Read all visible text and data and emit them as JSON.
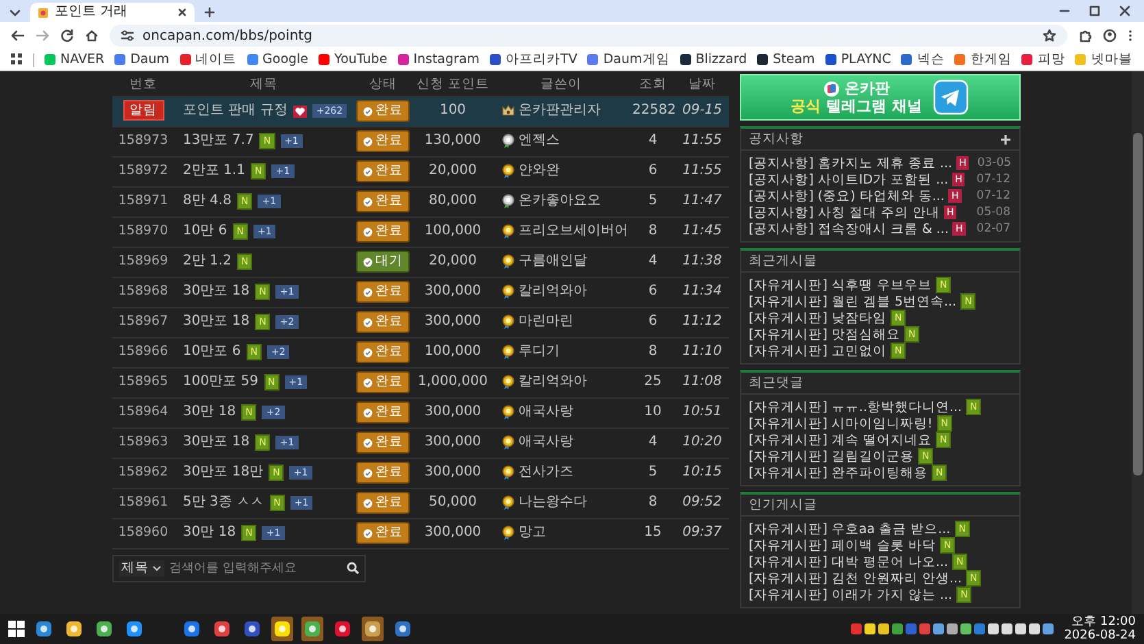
{
  "browser": {
    "tab": {
      "title": "포인트 거래"
    },
    "url": "oncapan.com/bbs/pointg",
    "bookmarks": [
      {
        "label": "NAVER",
        "color": "#03c75a"
      },
      {
        "label": "Daum",
        "color": "#4a7cf0"
      },
      {
        "label": "네이트",
        "color": "#e8202a"
      },
      {
        "label": "Google",
        "color": "#4285f4"
      },
      {
        "label": "YouTube",
        "color": "#ff0000"
      },
      {
        "label": "Instagram",
        "color": "#d6249f"
      },
      {
        "label": "아프리카TV",
        "color": "#2a4fc8"
      },
      {
        "label": "Daum게임",
        "color": "#5a7cf0"
      },
      {
        "label": "Blizzard",
        "color": "#1a2a3a"
      },
      {
        "label": "Steam",
        "color": "#1b2838"
      },
      {
        "label": "PLAYNC",
        "color": "#1a4fd0"
      },
      {
        "label": "넥슨",
        "color": "#2a6ad0"
      },
      {
        "label": "한게임",
        "color": "#f07020"
      },
      {
        "label": "피망",
        "color": "#e82040"
      },
      {
        "label": "넷마블",
        "color": "#f0c020"
      }
    ]
  },
  "table": {
    "columns": [
      "번호",
      "제목",
      "상태",
      "신청 포인트",
      "글쓴이",
      "조회",
      "날짜"
    ],
    "rows": [
      {
        "kind": "notice",
        "number": "알림",
        "title": "포인트 판매 규정",
        "hot": true,
        "comments": "+262",
        "status": {
          "label": "완료",
          "kind": "done"
        },
        "points": "100",
        "writer": "온카판관리자",
        "medal": {
          "kind": "admin"
        },
        "views": "22582",
        "date": "09-15"
      },
      {
        "kind": "post",
        "number": "158973",
        "title": "13만포 7.7",
        "hot": false,
        "new_badge": "N",
        "comments": "+1",
        "status": {
          "label": "완료",
          "kind": "done"
        },
        "points": "130,000",
        "writer": "엔젝스",
        "medal": {
          "kind": "silver"
        },
        "views": "4",
        "date": "11:55"
      },
      {
        "kind": "post",
        "number": "158972",
        "title": "2만포 1.1",
        "hot": false,
        "new_badge": "N",
        "comments": "+1",
        "status": {
          "label": "완료",
          "kind": "done"
        },
        "points": "20,000",
        "writer": "얀와완",
        "medal": {
          "kind": "gold"
        },
        "views": "6",
        "date": "11:55"
      },
      {
        "kind": "post",
        "number": "158971",
        "title": "8만 4.8",
        "hot": false,
        "new_badge": "N",
        "comments": "+1",
        "status": {
          "label": "완료",
          "kind": "done"
        },
        "points": "80,000",
        "writer": "온카좋아요오",
        "medal": {
          "kind": "silver"
        },
        "views": "5",
        "date": "11:47"
      },
      {
        "kind": "post",
        "number": "158970",
        "title": "10만 6",
        "hot": false,
        "new_badge": "N",
        "comments": "+1",
        "status": {
          "label": "완료",
          "kind": "done"
        },
        "points": "100,000",
        "writer": "프리오브세이버어",
        "medal": {
          "kind": "gold"
        },
        "views": "8",
        "date": "11:45"
      },
      {
        "kind": "post",
        "number": "158969",
        "title": "2만 1.2",
        "hot": false,
        "new_badge": "N",
        "status": {
          "label": "대기",
          "kind": "waiting"
        },
        "points": "20,000",
        "writer": "구름애인달",
        "medal": {
          "kind": "gold"
        },
        "views": "4",
        "date": "11:38"
      },
      {
        "kind": "post",
        "number": "158968",
        "title": "30만포 18",
        "hot": false,
        "new_badge": "N",
        "comments": "+1",
        "status": {
          "label": "완료",
          "kind": "done"
        },
        "points": "300,000",
        "writer": "칼리억와아",
        "medal": {
          "kind": "gold"
        },
        "views": "6",
        "date": "11:34"
      },
      {
        "kind": "post",
        "number": "158967",
        "title": "30만포 18",
        "hot": false,
        "new_badge": "N",
        "comments": "+2",
        "status": {
          "label": "완료",
          "kind": "done"
        },
        "points": "300,000",
        "writer": "마린마린",
        "medal": {
          "kind": "gold"
        },
        "views": "6",
        "date": "11:12"
      },
      {
        "kind": "post",
        "number": "158966",
        "title": "10만포 6",
        "hot": false,
        "new_badge": "N",
        "comments": "+2",
        "status": {
          "label": "완료",
          "kind": "done"
        },
        "points": "100,000",
        "writer": "루디기",
        "medal": {
          "kind": "gold"
        },
        "views": "8",
        "date": "11:10"
      },
      {
        "kind": "post",
        "number": "158965",
        "title": "100만포 59",
        "hot": false,
        "new_badge": "N",
        "comments": "+1",
        "status": {
          "label": "완료",
          "kind": "done"
        },
        "points": "1,000,000",
        "writer": "칼리억와아",
        "medal": {
          "kind": "gold"
        },
        "views": "25",
        "date": "11:08"
      },
      {
        "kind": "post",
        "number": "158964",
        "title": "30만 18",
        "hot": false,
        "new_badge": "N",
        "comments": "+2",
        "status": {
          "label": "완료",
          "kind": "done"
        },
        "points": "300,000",
        "writer": "애국사랑",
        "medal": {
          "kind": "gold"
        },
        "views": "10",
        "date": "10:51"
      },
      {
        "kind": "post",
        "number": "158963",
        "title": "30만포 18",
        "hot": false,
        "new_badge": "N",
        "comments": "+1",
        "status": {
          "label": "완료",
          "kind": "done"
        },
        "points": "300,000",
        "writer": "애국사랑",
        "medal": {
          "kind": "gold"
        },
        "views": "4",
        "date": "10:20"
      },
      {
        "kind": "post",
        "number": "158962",
        "title": "30만포 18만",
        "hot": false,
        "new_badge": "N",
        "comments": "+1",
        "status": {
          "label": "완료",
          "kind": "done"
        },
        "points": "300,000",
        "writer": "전사가즈",
        "medal": {
          "kind": "gold"
        },
        "views": "5",
        "date": "10:15"
      },
      {
        "kind": "post",
        "number": "158961",
        "title": "5만 3종 ㅅㅅ",
        "hot": false,
        "new_badge": "N",
        "comments": "+1",
        "status": {
          "label": "완료",
          "kind": "done"
        },
        "points": "50,000",
        "writer": "나는왕수다",
        "medal": {
          "kind": "gold"
        },
        "views": "8",
        "date": "09:52"
      },
      {
        "kind": "post",
        "number": "158960",
        "title": "30만 18",
        "hot": false,
        "new_badge": "N",
        "comments": "+1",
        "status": {
          "label": "완료",
          "kind": "done"
        },
        "points": "300,000",
        "writer": "망고",
        "medal": {
          "kind": "gold"
        },
        "views": "15",
        "date": "09:37"
      }
    ]
  },
  "search": {
    "field": "제목",
    "placeholder": "검색어를 입력해주세요"
  },
  "sidebar": {
    "banner": {
      "title": "온카판",
      "highlight": "공식",
      "subtitle": "텔레그램 채널"
    },
    "panels": [
      {
        "title": "공지사항",
        "more": true,
        "items": [
          {
            "text": "[공지사항] 홈카지노 제휴 종료 ...",
            "badge": {
              "label": "H",
              "kind": "hot"
            },
            "date": "03-05"
          },
          {
            "text": "[공지사항] 사이트ID가 포함된 ...",
            "badge": {
              "label": "H",
              "kind": "hot"
            },
            "date": "07-12"
          },
          {
            "text": "[공지사항] (중요) 타업체와 동...",
            "badge": {
              "label": "H",
              "kind": "hot"
            },
            "date": "07-12"
          },
          {
            "text": "[공지사항] 사칭 절대 주의 안내",
            "badge": {
              "label": "H",
              "kind": "hot"
            },
            "date": "05-08"
          },
          {
            "text": "[공지사항] 접속장애시 크롬 & ...",
            "badge": {
              "label": "H",
              "kind": "hot"
            },
            "date": "02-07"
          }
        ]
      },
      {
        "title": "최근게시물",
        "more": false,
        "items": [
          {
            "text": "[자유게시판] 식후땡 우브우브",
            "badge": {
              "label": "N",
              "kind": "new"
            }
          },
          {
            "text": "[자유게시판] 월린 겜블 5번연속...",
            "badge": {
              "label": "N",
              "kind": "new"
            }
          },
          {
            "text": "[자유게시판] 낮잠타임",
            "badge": {
              "label": "N",
              "kind": "new"
            }
          },
          {
            "text": "[자유게시판] 맛점심해요",
            "badge": {
              "label": "N",
              "kind": "new"
            }
          },
          {
            "text": "[자유게시판] 고민없이",
            "badge": {
              "label": "N",
              "kind": "new"
            }
          }
        ]
      },
      {
        "title": "최근댓글",
        "more": false,
        "items": [
          {
            "text": "[자유게시판] ㅠㅠ..항박했다니연...",
            "badge": {
              "label": "N",
              "kind": "new"
            }
          },
          {
            "text": "[자유게시판] 시마이임니짜링!",
            "badge": {
              "label": "N",
              "kind": "new"
            }
          },
          {
            "text": "[자유게시판] 계속 떨어지네요",
            "badge": {
              "label": "N",
              "kind": "new"
            }
          },
          {
            "text": "[자유게시판] 길림길이군용",
            "badge": {
              "label": "N",
              "kind": "new"
            }
          },
          {
            "text": "[자유게시판] 완주파이팅해용",
            "badge": {
              "label": "N",
              "kind": "new"
            }
          }
        ]
      },
      {
        "title": "인기게시글",
        "more": false,
        "items": [
          {
            "text": "[자유게시판] 우호aa 출금 받으...",
            "badge": {
              "label": "N",
              "kind": "new"
            }
          },
          {
            "text": "[자유게시판] 페이백 슬롯 바닥",
            "badge": {
              "label": "N",
              "kind": "new"
            }
          },
          {
            "text": "[자유게시판] 대박 평문어 나오...",
            "badge": {
              "label": "N",
              "kind": "new"
            }
          },
          {
            "text": "[자유게시판] 김천 안원짜리 안생...",
            "badge": {
              "label": "N",
              "kind": "new"
            }
          },
          {
            "text": "[자유게시판] 이래가 가지 않는 ...",
            "badge": {
              "label": "N",
              "kind": "new"
            }
          }
        ]
      }
    ]
  },
  "taskbar": {
    "apps": [
      {
        "color": "#2b88d8",
        "selected": false
      },
      {
        "color": "#f0b830",
        "selected": false
      },
      {
        "color": "#4caf50",
        "selected": false
      },
      {
        "color": "#1e90ff",
        "selected": false
      },
      {
        "color": "#1a73e8",
        "selected": false
      },
      {
        "color": "#e04040",
        "selected": false
      },
      {
        "color": "#3050c0",
        "selected": false
      },
      {
        "color": "#f9e000",
        "selected": true
      },
      {
        "color": "#4caf50",
        "selected": true
      },
      {
        "color": "#e01030",
        "selected": false
      },
      {
        "color": "#c8a050",
        "selected": true
      },
      {
        "color": "#3070c0",
        "selected": false
      }
    ],
    "time": "오후 12:00",
    "date": "2026-08-24"
  }
}
